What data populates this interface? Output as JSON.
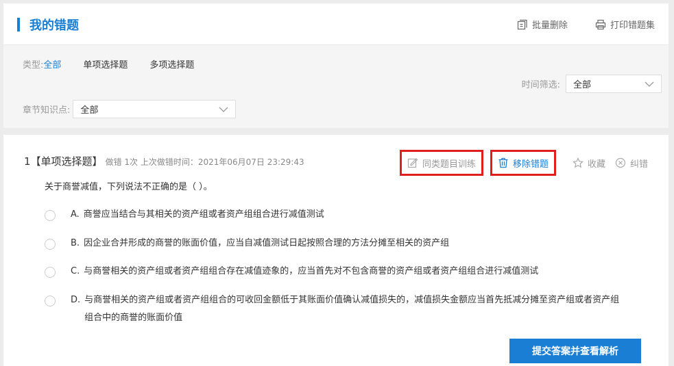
{
  "header": {
    "title": "我的错题",
    "batch_delete": "批量删除",
    "print_set": "打印错题集"
  },
  "filters": {
    "type_label": "类型:",
    "types": [
      "全部",
      "单项选择题",
      "多项选择题"
    ],
    "active_type": "全部",
    "time_label": "时间筛选:",
    "time_value": "全部",
    "chapter_label": "章节知识点:",
    "chapter_value": "全部"
  },
  "question": {
    "number": "1",
    "type": "【单项选择题】",
    "meta": "做错 1次 上次做错时间：2021年06月07日 23:29:43",
    "actions": {
      "similar_training": "同类题目训练",
      "remove": "移除错题",
      "favorite": "收藏",
      "correct": "纠错"
    },
    "stem": "关于商誉减值，下列说法不正确的是（   ）。",
    "options": [
      {
        "letter": "A.",
        "text": "商誉应当结合与其相关的资产组或者资产组组合进行减值测试"
      },
      {
        "letter": "B.",
        "text": "因企业合并形成的商誉的账面价值，应当自减值测试日起按照合理的方法分摊至相关的资产组"
      },
      {
        "letter": "C.",
        "text": "与商誉相关的资产组或者资产组组合存在减值迹象的，应当首先对不包含商誉的资产组或者资产组组合进行减值测试"
      },
      {
        "letter": "D.",
        "text": "与商誉相关的资产组或者资产组组合的可收回金额低于其账面价值确认减值损失的，减值损失金额应当首先抵减分摊至资产组或者资产组组合中的商誉的账面价值"
      }
    ],
    "submit_label": "提交答案并查看解析"
  },
  "colors": {
    "accent": "#1a7fd4",
    "highlight_box": "#e01e1e"
  }
}
